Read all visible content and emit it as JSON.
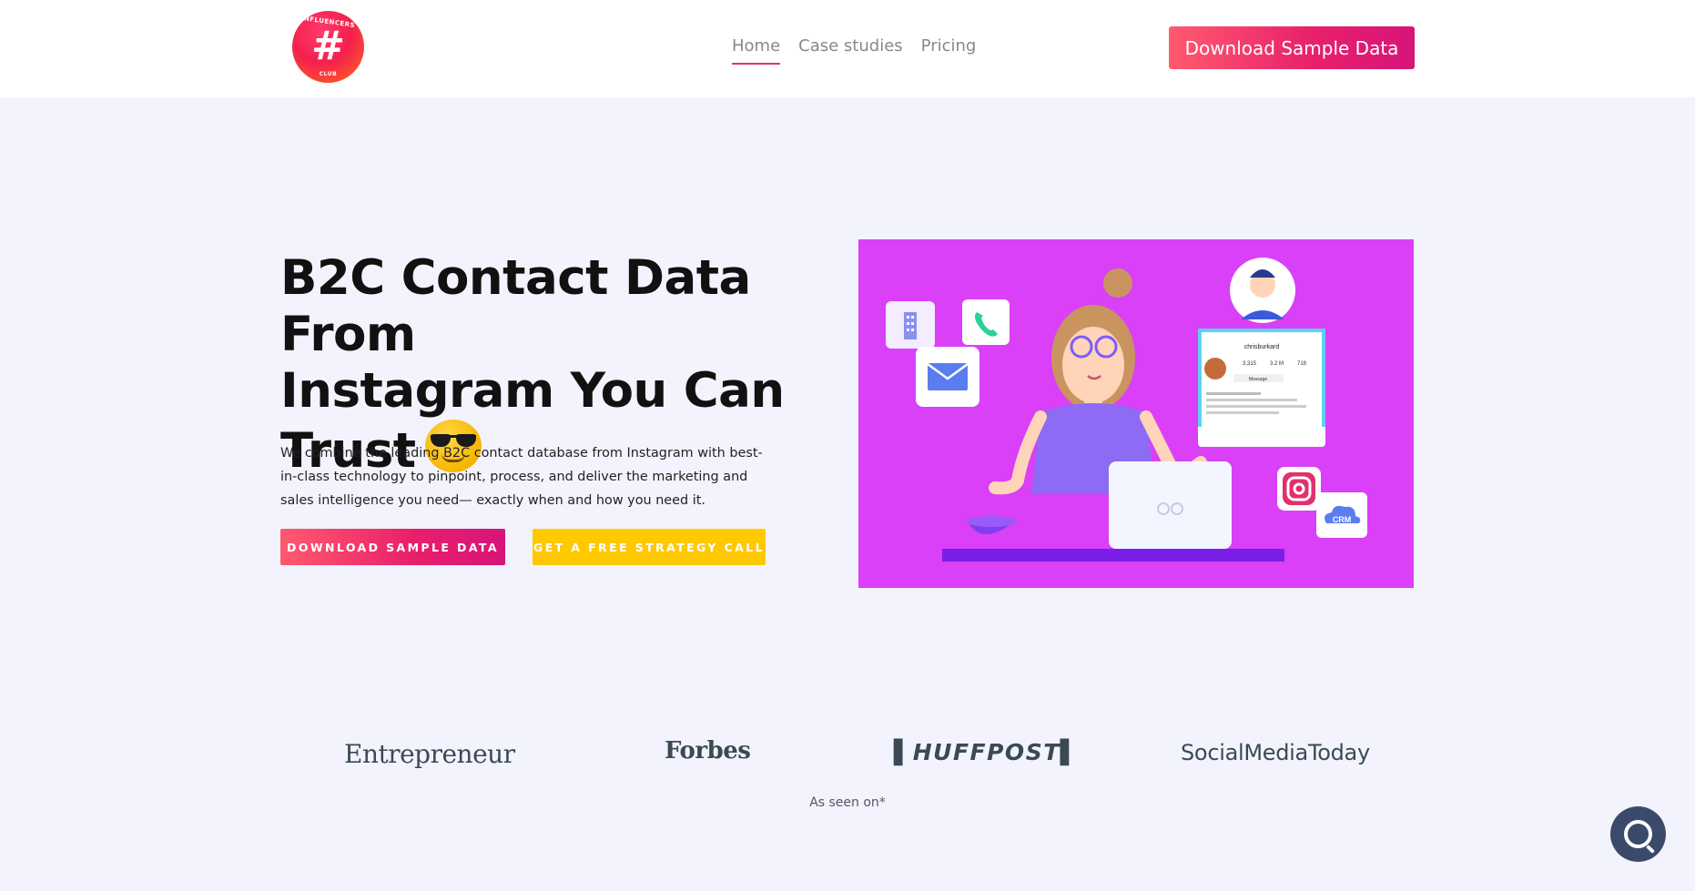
{
  "brand": {
    "logo_top_text": "INFLUENCERS",
    "logo_bottom_text": "CLUB",
    "logo_symbol": "#"
  },
  "nav": {
    "items": [
      {
        "label": "Home",
        "active": true
      },
      {
        "label": "Case studies"
      },
      {
        "label": "Pricing"
      }
    ]
  },
  "header": {
    "cta_label": "Download Sample Data"
  },
  "hero": {
    "title_lines": [
      "B2C Contact Data From",
      "Instagram You Can",
      "Trust"
    ],
    "emoji": "smiling-face-with-sunglasses",
    "description": "We combine the leading B2C contact database from Instagram with best-in-class technology to pinpoint, process, and deliver the marketing and sales intelligence you need— exactly when and how you need it.",
    "primary_cta": "DOWNLOAD SAMPLE DATA",
    "secondary_cta": "GET A FREE STRATEGY CALL"
  },
  "illustration": {
    "profile_username": "chrisburkard",
    "profile_stats": [
      "3,315",
      "3.2 M",
      "718"
    ],
    "message_label": "Message",
    "crm_label": "CRM"
  },
  "press": {
    "logos": [
      "Entrepreneur",
      "Forbes",
      "HUFFPOST",
      "SocialMediaToday"
    ],
    "caption": "As seen on*"
  },
  "colors": {
    "accent": "#e81f6b",
    "secondary": "#ffc900",
    "illustration_bg": "#d940f7",
    "chat": "#3b4a6b"
  }
}
